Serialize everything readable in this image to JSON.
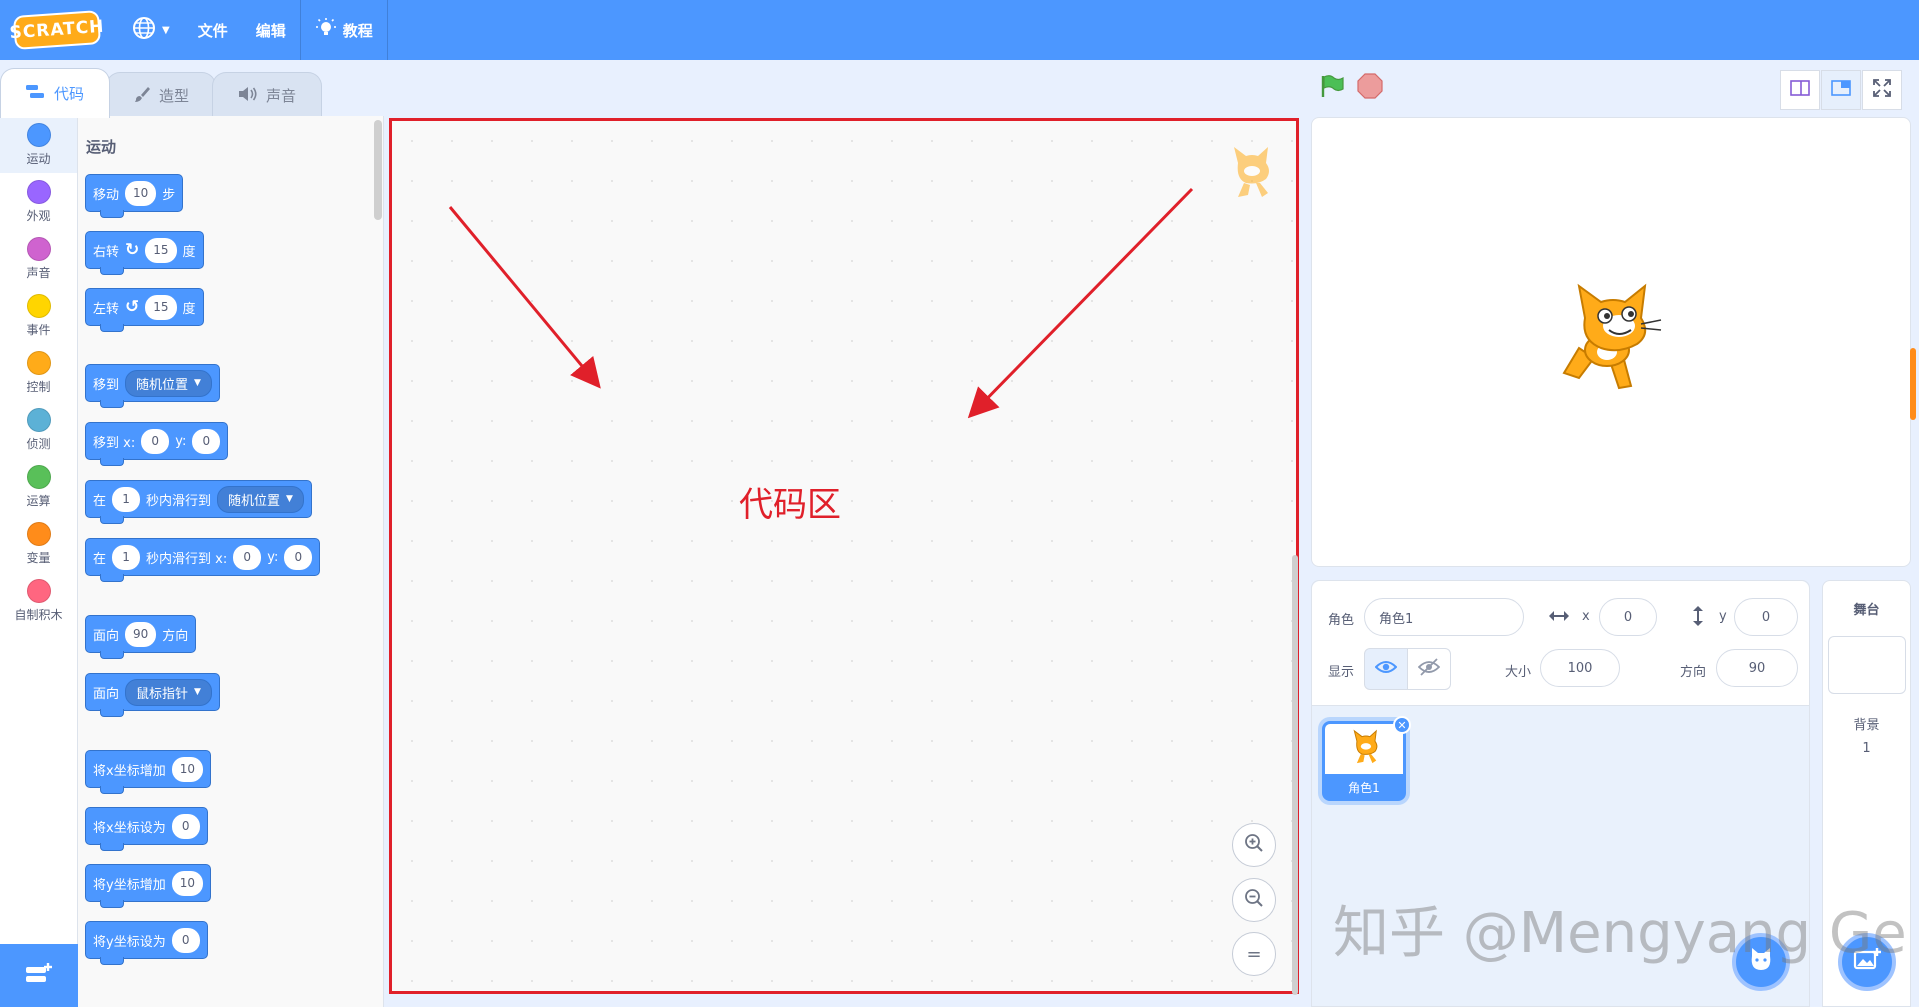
{
  "menubar": {
    "logo": "SCRATCH",
    "file": "文件",
    "edit": "编辑",
    "tutorials": "教程"
  },
  "tabs": {
    "code": "代码",
    "costumes": "造型",
    "sounds": "声音"
  },
  "categories": [
    {
      "label": "运动",
      "color": "#4c97ff"
    },
    {
      "label": "外观",
      "color": "#9966ff"
    },
    {
      "label": "声音",
      "color": "#cf63cf"
    },
    {
      "label": "事件",
      "color": "#ffd500"
    },
    {
      "label": "控制",
      "color": "#ffab19"
    },
    {
      "label": "侦测",
      "color": "#5cb1d6"
    },
    {
      "label": "运算",
      "color": "#59c059"
    },
    {
      "label": "变量",
      "color": "#ff8c1a"
    },
    {
      "label": "自制积木",
      "color": "#ff6680"
    }
  ],
  "palette": {
    "title": "运动",
    "move": {
      "a": "移动",
      "v": "10",
      "b": "步"
    },
    "turn_right": {
      "a": "右转",
      "v": "15",
      "b": "度"
    },
    "turn_left": {
      "a": "左转",
      "v": "15",
      "b": "度"
    },
    "goto": {
      "a": "移到",
      "dd": "随机位置"
    },
    "goto_xy": {
      "a": "移到 x:",
      "x": "0",
      "yl": "y:",
      "y": "0"
    },
    "glide": {
      "a": "在",
      "v": "1",
      "b": "秒内滑行到",
      "dd": "随机位置"
    },
    "glide_xy": {
      "a": "在",
      "v": "1",
      "b": "秒内滑行到 x:",
      "x": "0",
      "yl": "y:",
      "y": "0"
    },
    "point_dir": {
      "a": "面向",
      "v": "90",
      "b": "方向"
    },
    "point_towards": {
      "a": "面向",
      "dd": "鼠标指针"
    },
    "change_x": {
      "a": "将x坐标增加",
      "v": "10"
    },
    "set_x": {
      "a": "将x坐标设为",
      "v": "0"
    },
    "change_y": {
      "a": "将y坐标增加",
      "v": "10"
    },
    "set_y": {
      "a": "将y坐标设为",
      "v": "0"
    }
  },
  "code_area": {
    "annotation": "代码区",
    "zoom_in": "+",
    "zoom_out": "−",
    "reset": "="
  },
  "sprite_info": {
    "sprite_label": "角色",
    "sprite_name": "角色1",
    "x_label": "x",
    "x_value": "0",
    "y_label": "y",
    "y_value": "0",
    "show_label": "显示",
    "size_label": "大小",
    "size_value": "100",
    "direction_label": "方向",
    "direction_value": "90"
  },
  "sprite_list": [
    {
      "name": "角色1"
    }
  ],
  "stage_selector": {
    "title": "舞台",
    "backdrops_label": "背景",
    "backdrops_count": "1"
  },
  "watermark": "知乎 @Mengyang Ge",
  "colors": {
    "menubar": "#4c97ff",
    "annotation": "#e0202a",
    "motion": "#4c97ff"
  }
}
